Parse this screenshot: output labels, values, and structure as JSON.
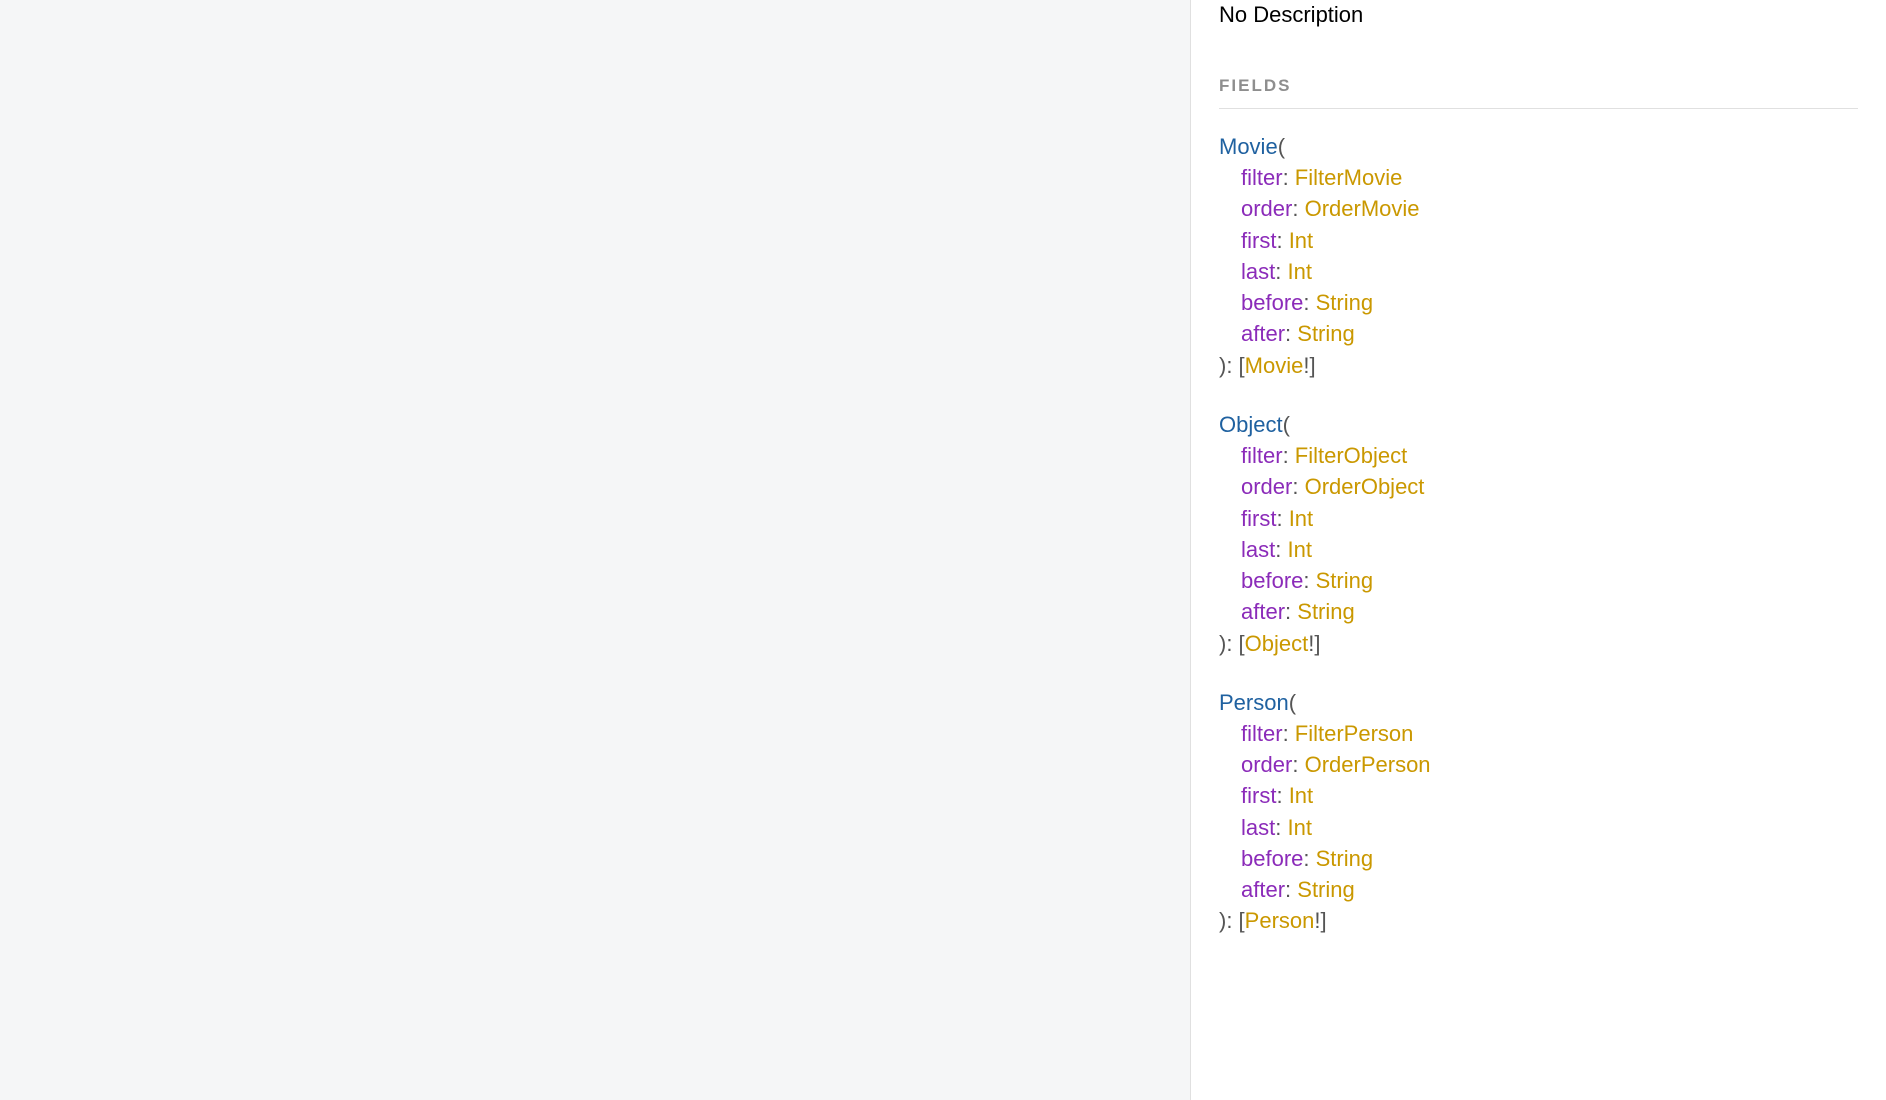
{
  "description": "No Description",
  "sectionLabel": "FIELDS",
  "punct": {
    "openParen": "(",
    "closeParenColonBracket": "): [",
    "bangBracket": "!]",
    "colon": ": "
  },
  "fields": [
    {
      "name": "Movie",
      "returnType": "Movie",
      "args": [
        {
          "name": "filter",
          "type": "FilterMovie"
        },
        {
          "name": "order",
          "type": "OrderMovie"
        },
        {
          "name": "first",
          "type": "Int"
        },
        {
          "name": "last",
          "type": "Int"
        },
        {
          "name": "before",
          "type": "String"
        },
        {
          "name": "after",
          "type": "String"
        }
      ]
    },
    {
      "name": "Object",
      "returnType": "Object",
      "args": [
        {
          "name": "filter",
          "type": "FilterObject"
        },
        {
          "name": "order",
          "type": "OrderObject"
        },
        {
          "name": "first",
          "type": "Int"
        },
        {
          "name": "last",
          "type": "Int"
        },
        {
          "name": "before",
          "type": "String"
        },
        {
          "name": "after",
          "type": "String"
        }
      ]
    },
    {
      "name": "Person",
      "returnType": "Person",
      "args": [
        {
          "name": "filter",
          "type": "FilterPerson"
        },
        {
          "name": "order",
          "type": "OrderPerson"
        },
        {
          "name": "first",
          "type": "Int"
        },
        {
          "name": "last",
          "type": "Int"
        },
        {
          "name": "before",
          "type": "String"
        },
        {
          "name": "after",
          "type": "String"
        }
      ]
    }
  ]
}
